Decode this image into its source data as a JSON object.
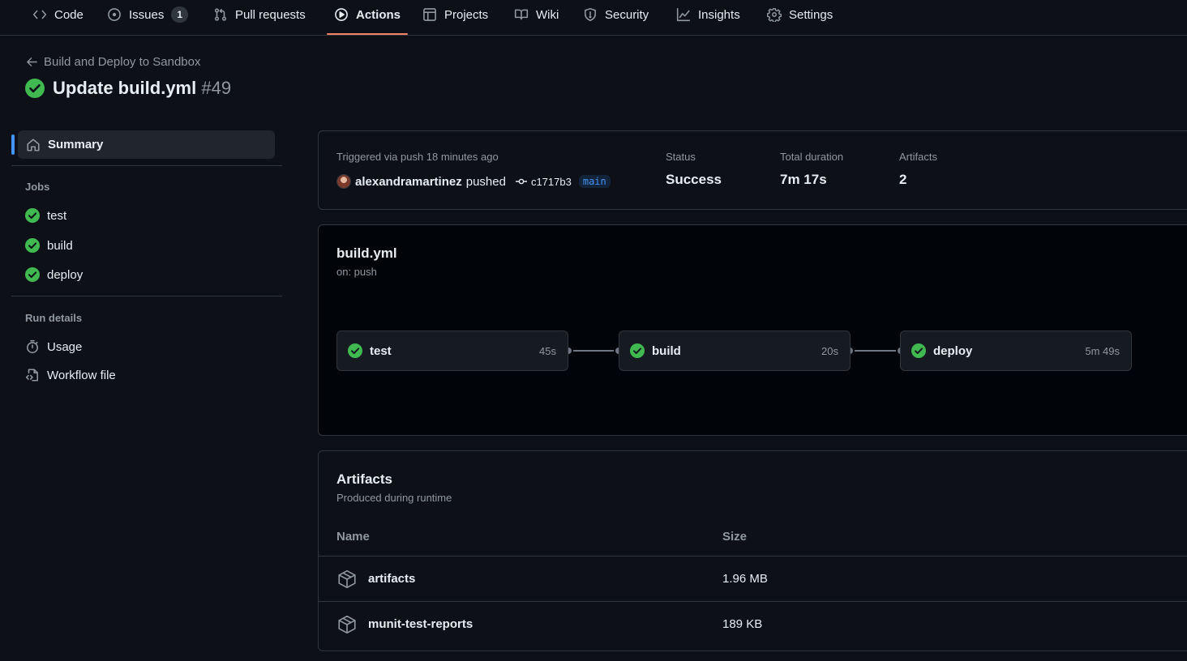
{
  "nav": {
    "items": [
      {
        "label": "Code",
        "icon": "code-icon"
      },
      {
        "label": "Issues",
        "icon": "issue-icon",
        "count": "1"
      },
      {
        "label": "Pull requests",
        "icon": "pull-request-icon"
      },
      {
        "label": "Actions",
        "icon": "play-icon",
        "active": true
      },
      {
        "label": "Projects",
        "icon": "table-icon"
      },
      {
        "label": "Wiki",
        "icon": "book-icon"
      },
      {
        "label": "Security",
        "icon": "shield-icon"
      },
      {
        "label": "Insights",
        "icon": "graph-icon"
      },
      {
        "label": "Settings",
        "icon": "gear-icon"
      }
    ]
  },
  "header": {
    "back_label": "Build and Deploy to Sandbox",
    "title": "Update build.yml",
    "run_number": "#49"
  },
  "sidebar": {
    "summary_label": "Summary",
    "jobs_heading": "Jobs",
    "jobs": [
      {
        "label": "test"
      },
      {
        "label": "build"
      },
      {
        "label": "deploy"
      }
    ],
    "run_details_heading": "Run details",
    "run_details": [
      {
        "label": "Usage",
        "icon": "stopwatch-icon"
      },
      {
        "label": "Workflow file",
        "icon": "file-code-icon"
      }
    ]
  },
  "status": {
    "trigger_text": "Triggered via push 18 minutes ago",
    "user": "alexandramartinez",
    "action": "pushed",
    "commit": "c1717b3",
    "branch": "main",
    "status_label": "Status",
    "status_value": "Success",
    "duration_label": "Total duration",
    "duration_value": "7m 17s",
    "artifacts_label": "Artifacts",
    "artifacts_value": "2"
  },
  "workflow": {
    "name": "build.yml",
    "trigger": "on: push",
    "jobs": [
      {
        "name": "test",
        "duration": "45s"
      },
      {
        "name": "build",
        "duration": "20s"
      },
      {
        "name": "deploy",
        "duration": "5m 49s"
      }
    ]
  },
  "artifacts": {
    "title": "Artifacts",
    "subtitle": "Produced during runtime",
    "col_name": "Name",
    "col_size": "Size",
    "rows": [
      {
        "name": "artifacts",
        "size": "1.96 MB"
      },
      {
        "name": "munit-test-reports",
        "size": "189 KB"
      }
    ]
  },
  "colors": {
    "success": "#3fb950",
    "accent_underline": "#f78166",
    "link_blue": "#4493f8",
    "background": "#0d1117"
  }
}
